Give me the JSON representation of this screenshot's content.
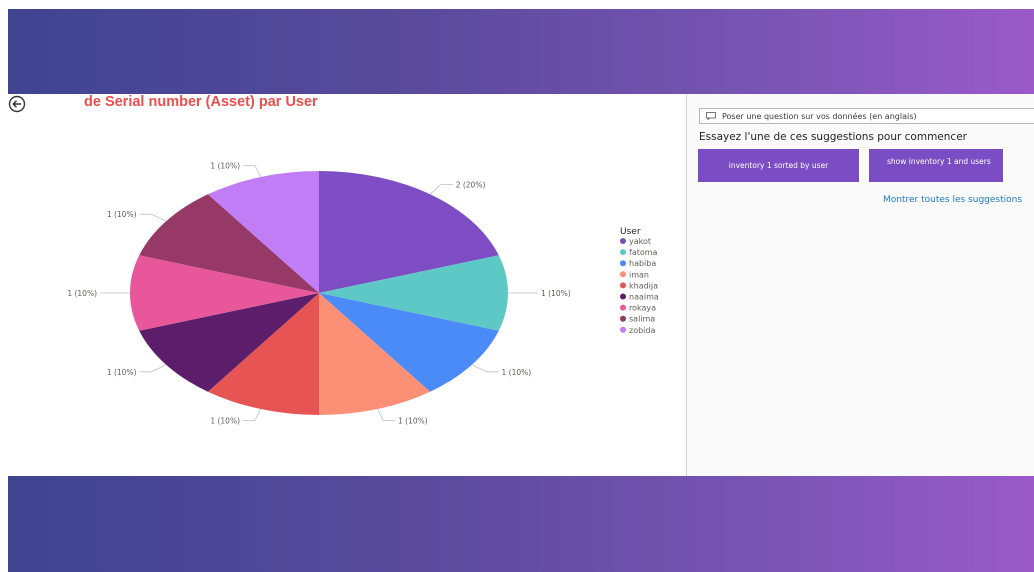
{
  "report": {
    "title": "de Serial number (Asset) par User"
  },
  "qa": {
    "input_placeholder": "Poser une question sur vos données (en anglais)",
    "hint": "Essayez l'une de ces suggestions pour commencer",
    "suggestions": [
      "inventory 1 sorted by user",
      "show inventory 1 and users"
    ],
    "show_all": "Montrer toutes les suggestions"
  },
  "chart_data": {
    "type": "pie",
    "legend_title": "User",
    "legend_position": "right",
    "slices": [
      {
        "name": "yakot",
        "value": 2,
        "label": "2 (20%)",
        "color": "#7e4dc4"
      },
      {
        "name": "fatoma",
        "value": 1,
        "label": "1 (10%)",
        "color": "#5ec8c6"
      },
      {
        "name": "habiba",
        "value": 1,
        "label": "1 (10%)",
        "color": "#4a8bf7"
      },
      {
        "name": "iman",
        "value": 1,
        "label": "1 (10%)",
        "color": "#fc9077"
      },
      {
        "name": "khadija",
        "value": 1,
        "label": "1 (10%)",
        "color": "#e65454"
      },
      {
        "name": "naaima",
        "value": 1,
        "label": "1 (10%)",
        "color": "#5c1e6a"
      },
      {
        "name": "rokaya",
        "value": 1,
        "label": "1 (10%)",
        "color": "#e8579a"
      },
      {
        "name": "salima",
        "value": 1,
        "label": "1 (10%)",
        "color": "#963966"
      },
      {
        "name": "zobida",
        "value": 1,
        "label": "1 (10%)",
        "color": "#c07df5"
      }
    ]
  }
}
